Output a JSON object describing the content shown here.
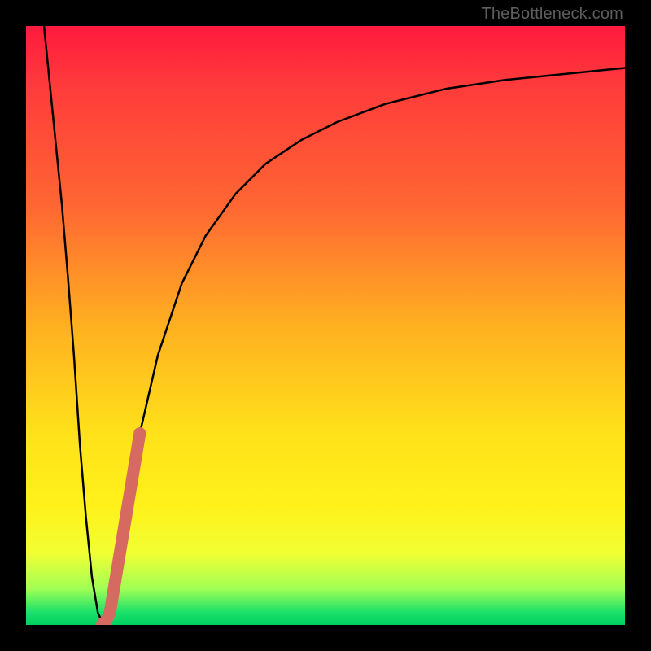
{
  "watermark": "TheBottleneck.com",
  "chart_data": {
    "type": "line",
    "title": "",
    "xlabel": "",
    "ylabel": "",
    "xlim": [
      0,
      100
    ],
    "ylim": [
      0,
      100
    ],
    "grid": false,
    "series": [
      {
        "name": "curve",
        "color": "#000000",
        "x": [
          3,
          4,
          5,
          6,
          7,
          8,
          9,
          10,
          11,
          12,
          13,
          14,
          15,
          17,
          19,
          22,
          26,
          30,
          35,
          40,
          46,
          52,
          60,
          70,
          80,
          90,
          100
        ],
        "y": [
          100,
          90,
          80,
          70,
          58,
          45,
          30,
          18,
          8,
          2,
          0,
          2,
          8,
          20,
          32,
          45,
          57,
          65,
          72,
          77,
          81,
          84,
          87,
          89.5,
          91,
          92,
          93
        ]
      },
      {
        "name": "highlight-segment",
        "color": "#d66a60",
        "x": [
          13,
          14,
          15,
          17,
          19
        ],
        "y": [
          0,
          2,
          8,
          20,
          32
        ]
      },
      {
        "name": "highlight-dot",
        "color": "#d66a60",
        "x": [
          13
        ],
        "y": [
          0
        ]
      }
    ]
  }
}
